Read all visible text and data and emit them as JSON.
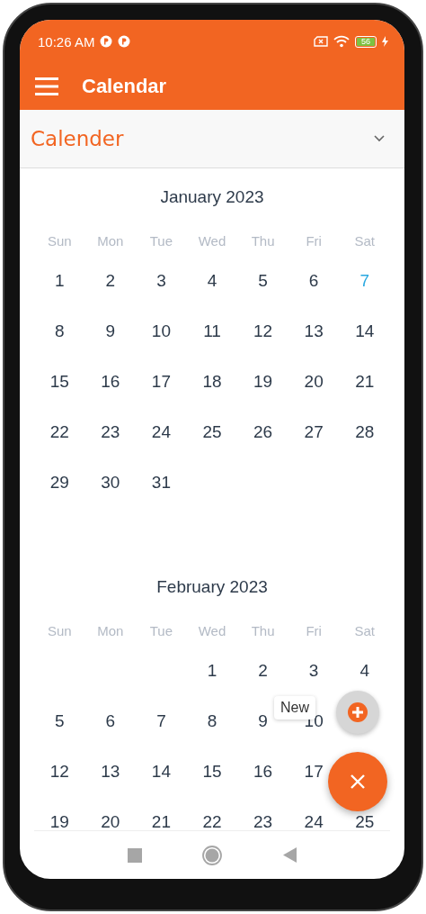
{
  "status_bar": {
    "time": "10:26 AM",
    "battery": "56"
  },
  "app_bar": {
    "title": "Calendar"
  },
  "dropdown": {
    "value": "Calender",
    "expanded": false
  },
  "months": [
    {
      "title": "January 2023",
      "weekdays": [
        "Sun",
        "Mon",
        "Tue",
        "Wed",
        "Thu",
        "Fri",
        "Sat"
      ],
      "weeks": [
        {
          "kind": "full",
          "days": [
            {
              "day": "1",
              "today": false
            },
            {
              "day": "2",
              "today": false
            },
            {
              "day": "3",
              "today": false
            },
            {
              "day": "4",
              "today": false
            },
            {
              "day": "5",
              "today": false
            },
            {
              "day": "6",
              "today": false
            },
            {
              "day": "7",
              "today": true
            }
          ]
        },
        {
          "kind": "full",
          "days": [
            {
              "day": "8",
              "today": false
            },
            {
              "day": "9",
              "today": false
            },
            {
              "day": "10",
              "today": false
            },
            {
              "day": "11",
              "today": false
            },
            {
              "day": "12",
              "today": false
            },
            {
              "day": "13",
              "today": false
            },
            {
              "day": "14",
              "today": false
            }
          ]
        },
        {
          "kind": "full",
          "days": [
            {
              "day": "15",
              "today": false
            },
            {
              "day": "16",
              "today": false
            },
            {
              "day": "17",
              "today": false
            },
            {
              "day": "18",
              "today": false
            },
            {
              "day": "19",
              "today": false
            },
            {
              "day": "20",
              "today": false
            },
            {
              "day": "21",
              "today": false
            }
          ]
        },
        {
          "kind": "full",
          "days": [
            {
              "day": "22",
              "today": false
            },
            {
              "day": "23",
              "today": false
            },
            {
              "day": "24",
              "today": false
            },
            {
              "day": "25",
              "today": false
            },
            {
              "day": "26",
              "today": false
            },
            {
              "day": "27",
              "today": false
            },
            {
              "day": "28",
              "today": false
            }
          ]
        },
        {
          "kind": "trailing",
          "days": [
            {
              "day": "29",
              "today": false
            },
            {
              "day": "30",
              "today": false
            },
            {
              "day": "31",
              "today": false
            }
          ]
        }
      ]
    },
    {
      "title": "February 2023",
      "weekdays": [
        "Sun",
        "Mon",
        "Tue",
        "Wed",
        "Thu",
        "Fri",
        "Sat"
      ],
      "weeks": [
        {
          "kind": "leading",
          "days": [
            {
              "day": "1",
              "today": false
            },
            {
              "day": "2",
              "today": false
            },
            {
              "day": "3",
              "today": false
            },
            {
              "day": "4",
              "today": false
            }
          ]
        },
        {
          "kind": "full",
          "days": [
            {
              "day": "5",
              "today": false
            },
            {
              "day": "6",
              "today": false
            },
            {
              "day": "7",
              "today": false
            },
            {
              "day": "8",
              "today": false
            },
            {
              "day": "9",
              "today": false
            },
            {
              "day": "10",
              "today": false
            }
          ]
        },
        {
          "kind": "full",
          "days": [
            {
              "day": "12",
              "today": false
            },
            {
              "day": "13",
              "today": false
            },
            {
              "day": "14",
              "today": false
            },
            {
              "day": "15",
              "today": false
            },
            {
              "day": "16",
              "today": false
            },
            {
              "day": "17",
              "today": false
            }
          ]
        },
        {
          "kind": "full",
          "days": [
            {
              "day": "19",
              "today": false
            },
            {
              "day": "20",
              "today": false
            },
            {
              "day": "21",
              "today": false
            },
            {
              "day": "22",
              "today": false
            },
            {
              "day": "23",
              "today": false
            },
            {
              "day": "24",
              "today": false
            },
            {
              "day": "25",
              "today": false
            }
          ]
        }
      ]
    }
  ],
  "speed_dial": {
    "open": true,
    "actions": [
      {
        "label": "New"
      }
    ]
  }
}
